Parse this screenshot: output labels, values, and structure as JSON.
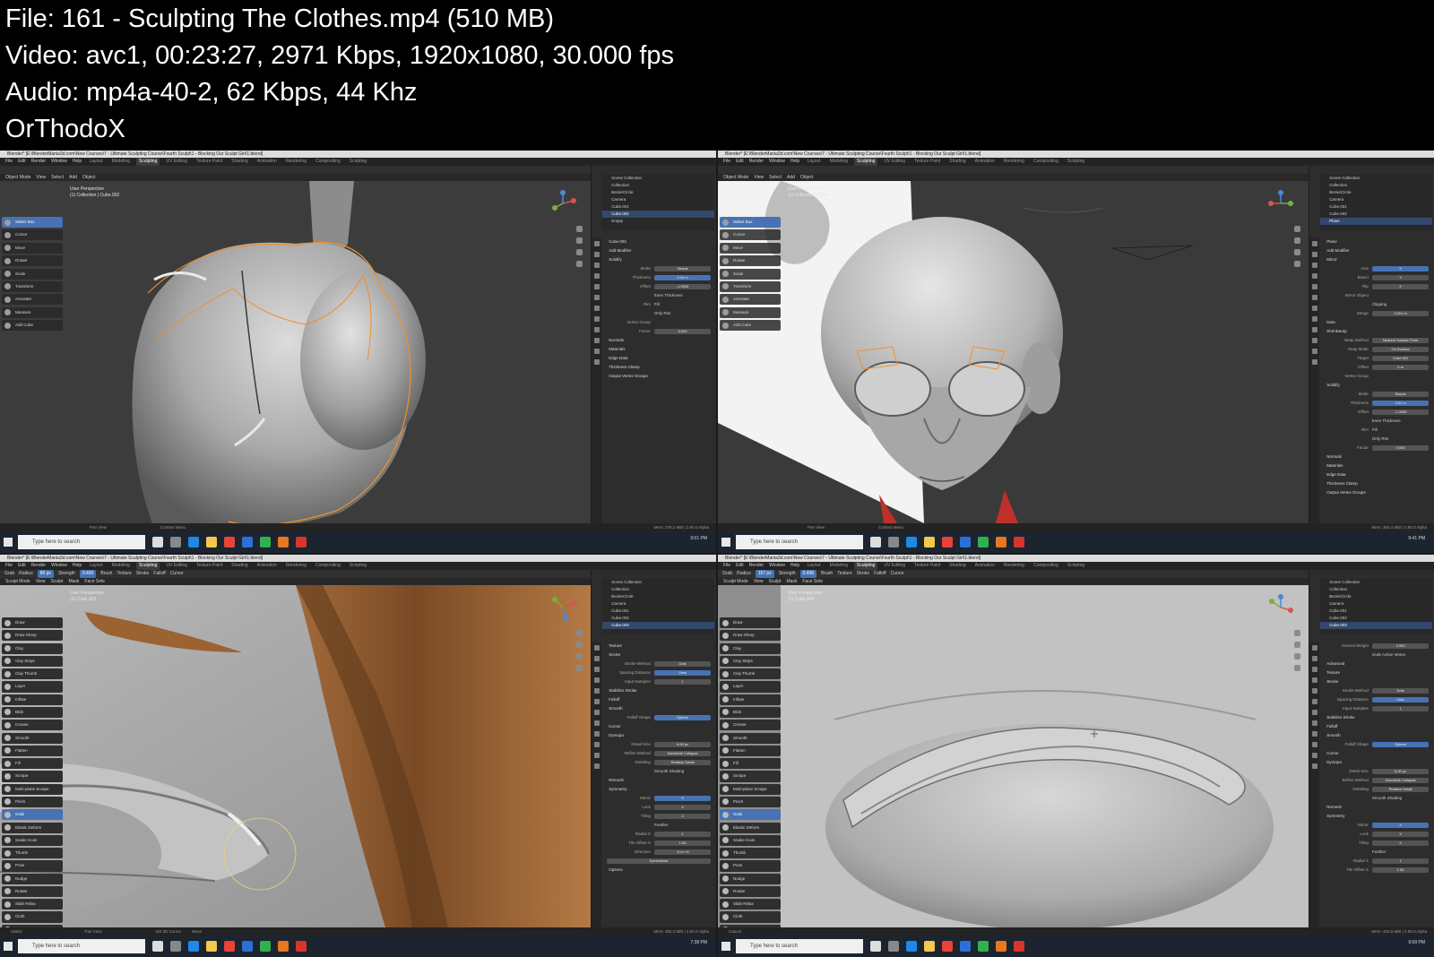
{
  "header": {
    "file_line": "File: 161 - Sculpting The Clothes.mp4 (510 MB)",
    "video_line": "Video: avc1, 00:23:27, 2971 Kbps, 1920x1080, 30.000 fps",
    "audio_line": "Audio: mp4a-40-2, 62 Kbps, 44 Khz",
    "author_line": "OrThodoX"
  },
  "common": {
    "window_title": "Blender* [E:\\BlenderMania3d.com\\New Courses\\7 - Ultimate Sculpting Course\\Fourth Sculpt\\1 - Blocking Our Sculpt Girl\\1.blend]",
    "menus": [
      "File",
      "Edit",
      "Render",
      "Window",
      "Help"
    ],
    "workspaces": [
      "Layout",
      "Modeling",
      "Sculpting",
      "UV Editing",
      "Texture Paint",
      "Shading",
      "Animation",
      "Rendering",
      "Compositing",
      "Scripting"
    ],
    "active_workspace": "Sculpting",
    "taskbar_search": "Type here to search",
    "outliner_title": "Scene Collection",
    "outliner_rows": [
      "Collection",
      "BezierCircle",
      "Camera",
      "Cube.001",
      "Cube.002",
      "Cube.003",
      "Empty"
    ],
    "colors": {
      "blender_bg": "#2b2b2b",
      "panel_bg": "#2d2d2d",
      "accent_blue": "#4772b3",
      "selection_orange": "#f0902a",
      "sculpt_grey": "#a6a6a6",
      "taskbar": "#1c2430"
    }
  },
  "shots": {
    "tl": {
      "mode": "Object Mode",
      "mode_menus": [
        "View",
        "Select",
        "Add",
        "Object"
      ],
      "overlay_line1": "User Perspective",
      "overlay_line2": "(1) Collection | Cube.002",
      "tools": [
        "Select Box",
        "Cursor",
        "Move",
        "Rotate",
        "Scale",
        "Transform",
        "Annotate",
        "Measure",
        "Add Cube"
      ],
      "active_tool": "Select Box",
      "selected_row": "Cube.002",
      "props": {
        "object": "Cube.002",
        "add_modifier": "Add Modifier",
        "modifier": "Solidify",
        "mode_label": "Mode",
        "mode_value": "Simple",
        "thickness_label": "Thickness",
        "thickness_value": "0.04 m",
        "offset_label": "Offset",
        "offset_value": "-1.0000",
        "even_thickness": "Even Thickness",
        "rim_label": "Rim",
        "fill": "Fill",
        "only_rim": "Only Rim",
        "vertex_group": "Vertex Group",
        "factor_label": "Factor",
        "factor_value": "0.000",
        "normals": "Normals",
        "materials": "Materials",
        "edge_data": "Edge Data",
        "thickness_clamp": "Thickness Clamp",
        "output_vertex_groups": "Output Vertex Groups"
      },
      "status_left": "Pan View",
      "status_mid": "Context Menu",
      "status_right": "Mem: 378.2 MiB | 2.90.0 Alpha",
      "clock": "9:01 PM"
    },
    "tr": {
      "mode": "Object Mode",
      "mode_menus": [
        "View",
        "Select",
        "Add",
        "Object"
      ],
      "overlay_line1": "User Perspective",
      "overlay_line2": "(1) Collection | Plane",
      "tools": [
        "Select Box",
        "Cursor",
        "Move",
        "Rotate",
        "Scale",
        "Transform",
        "Annotate",
        "Measure",
        "Add Cube"
      ],
      "active_tool": "Select Box",
      "selected_row": "Plane",
      "props": {
        "object": "Plane",
        "add_modifier": "Add Modifier",
        "mirror": "Mirror",
        "axis_label": "Axis",
        "bisect_label": "Bisect",
        "flip_label": "Flip",
        "x": "X",
        "y": "Y",
        "z": "Z",
        "mirror_object": "Mirror Object",
        "clipping": "Clipping",
        "merge": "Merge",
        "merge_value": "0.001 m",
        "data": "Data",
        "shrinkwrap": "Shrinkwrap",
        "wrap_method_label": "Wrap Method",
        "wrap_method_value": "Nearest Surface Point",
        "snap_mode_label": "Snap Mode",
        "snap_mode_value": "On Surface",
        "target_label": "Target",
        "target_value": "Cube.001",
        "offset_label": "Offset",
        "offset_value": "0 m",
        "vertex_group": "Vertex Group",
        "solidify": "Solidify",
        "mode_label": "Mode",
        "mode_value": "Simple",
        "thickness_label": "Thickness",
        "thickness_value": "0.01 m",
        "offset2_value": "-1.0000",
        "even_thickness": "Even Thickness",
        "rim_label": "Rim",
        "fill": "Fill",
        "only_rim": "Only Rim",
        "factor_label": "Factor",
        "factor_value": "0.000",
        "normals": "Normals",
        "materials": "Materials",
        "edge_data": "Edge Data",
        "thickness_clamp": "Thickness Clamp",
        "output_vertex_groups": "Output Vertex Groups"
      },
      "status_left": "Pan View",
      "status_mid": "Context Menu",
      "status_right": "Mem: 383.4 MiB | 2.90.0 Alpha",
      "clock": "9:41 PM"
    },
    "bl": {
      "mode": "Sculpt Mode",
      "mode_menus": [
        "View",
        "Sculpt",
        "Mask",
        "Face Sets"
      ],
      "tool_header": [
        "Grab",
        "Radius",
        "80 px",
        "Strength",
        "0.400",
        "Brush",
        "Texture",
        "Stroke",
        "Falloff",
        "Cursor"
      ],
      "overlay_line1": "User Perspective",
      "overlay_line2": "(1) Cube.003",
      "tools": [
        "Draw",
        "Draw Sharp",
        "Clay",
        "Clay Strips",
        "Clay Thumb",
        "Layer",
        "Inflate",
        "Blob",
        "Crease",
        "Smooth",
        "Flatten",
        "Fill",
        "Scrape",
        "Multi-plane Scrape",
        "Pinch",
        "Grab",
        "Elastic Deform",
        "Snake Hook",
        "Thumb",
        "Pose",
        "Nudge",
        "Rotate",
        "Slide Relax",
        "Cloth",
        "Simplify",
        "Mask"
      ],
      "active_tool": "Grab",
      "selected_row": "Cube.003",
      "props": {
        "texture": "Texture",
        "stroke": "Stroke",
        "stroke_method_label": "Stroke Method",
        "stroke_method_value": "Dots",
        "spacing_label": "Spacing Distance",
        "spacing_view": "View",
        "spacing_scene": "Scene",
        "input_samples_label": "Input Samples",
        "input_samples_value": "1",
        "stabilize": "Stabilize Stroke",
        "falloff": "Falloff",
        "smooth": "Smooth",
        "falloff_shape_label": "Falloff Shape",
        "sphere": "Sphere",
        "projected": "Projected",
        "cursor": "Cursor",
        "dyntopo": "Dyntopo",
        "detail_size_label": "Detail Size",
        "detail_size_value": "6.00 px",
        "refine_label": "Refine Method",
        "refine_value": "Subdivide Collapse",
        "detailing_label": "Detailing",
        "detailing_value": "Relative Detail",
        "smooth_shading": "Smooth Shading",
        "remesh": "Remesh",
        "symmetry": "Symmetry",
        "mirror_label": "Mirror",
        "lock_label": "Lock",
        "tiling_label": "Tiling",
        "feather": "Feather",
        "radial_label": "Radial X",
        "radial_x": "1",
        "radial_y": "1",
        "radial_z": "1",
        "tile_offset_label": "Tile Offset X",
        "tile_x": "1.00",
        "tile_y": "1.00",
        "tile_z": "1.00",
        "direction_label": "Direction",
        "direction_value": "-X to +X",
        "symmetrize": "Symmetrize",
        "options": "Options"
      },
      "status_left": "Select",
      "status_mid": "Pan View",
      "status_mid2": "Set 3D Cursor",
      "status_mid3": "Move",
      "status_right": "Mem: 382.3 MiB | 2.90.0 Alpha",
      "clock": "7:38 PM"
    },
    "br": {
      "mode": "Sculpt Mode",
      "mode_menus": [
        "View",
        "Sculpt",
        "Mask",
        "Face Sets"
      ],
      "tool_header": [
        "Grab",
        "Radius",
        "157 px",
        "Strength",
        "0.400",
        "Brush",
        "Texture",
        "Stroke",
        "Falloff",
        "Cursor"
      ],
      "overlay_line1": "User Perspective",
      "overlay_line2": "(1) Cube.003",
      "tools": [
        "Draw",
        "Draw Sharp",
        "Clay",
        "Clay Strips",
        "Clay Thumb",
        "Layer",
        "Inflate",
        "Blob",
        "Crease",
        "Smooth",
        "Flatten",
        "Fill",
        "Scrape",
        "Multi-plane Scrape",
        "Pinch",
        "Grab",
        "Elastic Deform",
        "Snake Hook",
        "Thumb",
        "Pose",
        "Nudge",
        "Rotate",
        "Slide Relax",
        "Cloth",
        "Simplify",
        "Mask"
      ],
      "active_tool": "Grab",
      "selected_row": "Cube.003",
      "props": {
        "normal_weight_label": "Normal Weight",
        "normal_weight_value": "0.000",
        "grab_active": "Grab Active Vertex",
        "advanced": "Advanced",
        "texture": "Texture",
        "stroke": "Stroke",
        "stroke_method_label": "Stroke Method",
        "stroke_method_value": "Dots",
        "spacing_label": "Spacing Distance",
        "spacing_view": "View",
        "spacing_scene": "Scene",
        "input_samples_label": "Input Samples",
        "input_samples_value": "1",
        "stabilize": "Stabilize Stroke",
        "falloff": "Falloff",
        "smooth": "Smooth",
        "falloff_shape_label": "Falloff Shape",
        "sphere": "Sphere",
        "projected": "Projected",
        "cursor": "Cursor",
        "dyntopo": "Dyntopo",
        "detail_size_label": "Detail Size",
        "detail_size_value": "6.00 px",
        "refine_label": "Refine Method",
        "refine_value": "Subdivide Collapse",
        "detailing_label": "Detailing",
        "detailing_value": "Relative Detail",
        "smooth_shading": "Smooth Shading",
        "remesh": "Remesh",
        "symmetry": "Symmetry",
        "mirror_label": "Mirror",
        "lock_label": "Lock",
        "tiling_label": "Tiling",
        "feather": "Feather",
        "radial_label": "Radial X",
        "radial_x": "1",
        "radial_y": "1",
        "radial_z": "1",
        "tile_offset_label": "Tile Offset X",
        "tile_x": "1.00",
        "tile_y": "1.00",
        "tile_z": "1.00"
      },
      "status_left": "Cancel",
      "status_right": "Mem: 403.6 MiB | 2.90.0 Alpha",
      "clock": "9:09 PM"
    }
  }
}
